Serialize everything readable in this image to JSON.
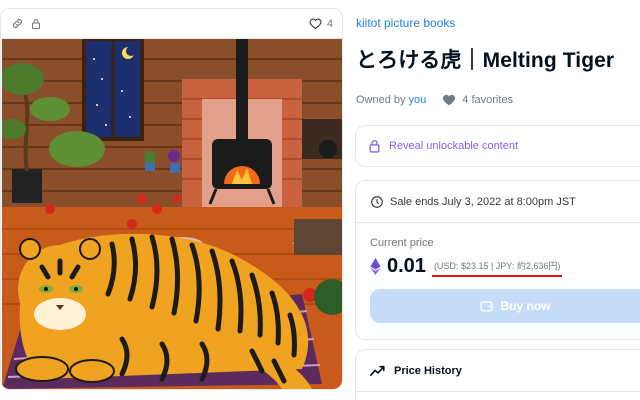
{
  "image_card": {
    "favorites_count": "4",
    "icons": [
      "link-icon",
      "lock-icon",
      "heart-outline-icon"
    ],
    "artwork_subject": "tiger lying on a rug by a wood stove"
  },
  "item": {
    "collection": "kiitot picture books",
    "title": "とろける虎｜Melting Tiger",
    "owned_by_label": "Owned by",
    "owner": "you",
    "favorites": "4 favorites"
  },
  "unlockable": {
    "label": "Reveal unlockable content"
  },
  "sale": {
    "ends_text": "Sale ends July 3, 2022 at 8:00pm JST",
    "current_price_label": "Current price",
    "eth_value": "0.01",
    "fiat_text": "(USD: $23.15 | JPY: 約2,636円)",
    "buy_label": "Buy now"
  },
  "history": {
    "label": "Price History"
  },
  "colors": {
    "link_blue": "#2081e2",
    "unlock_purple": "#8b5cf6",
    "buy_button_disabled": "#c6dcf8",
    "highlight_red": "#e01414",
    "eth_purple": "#6d4bd6"
  }
}
